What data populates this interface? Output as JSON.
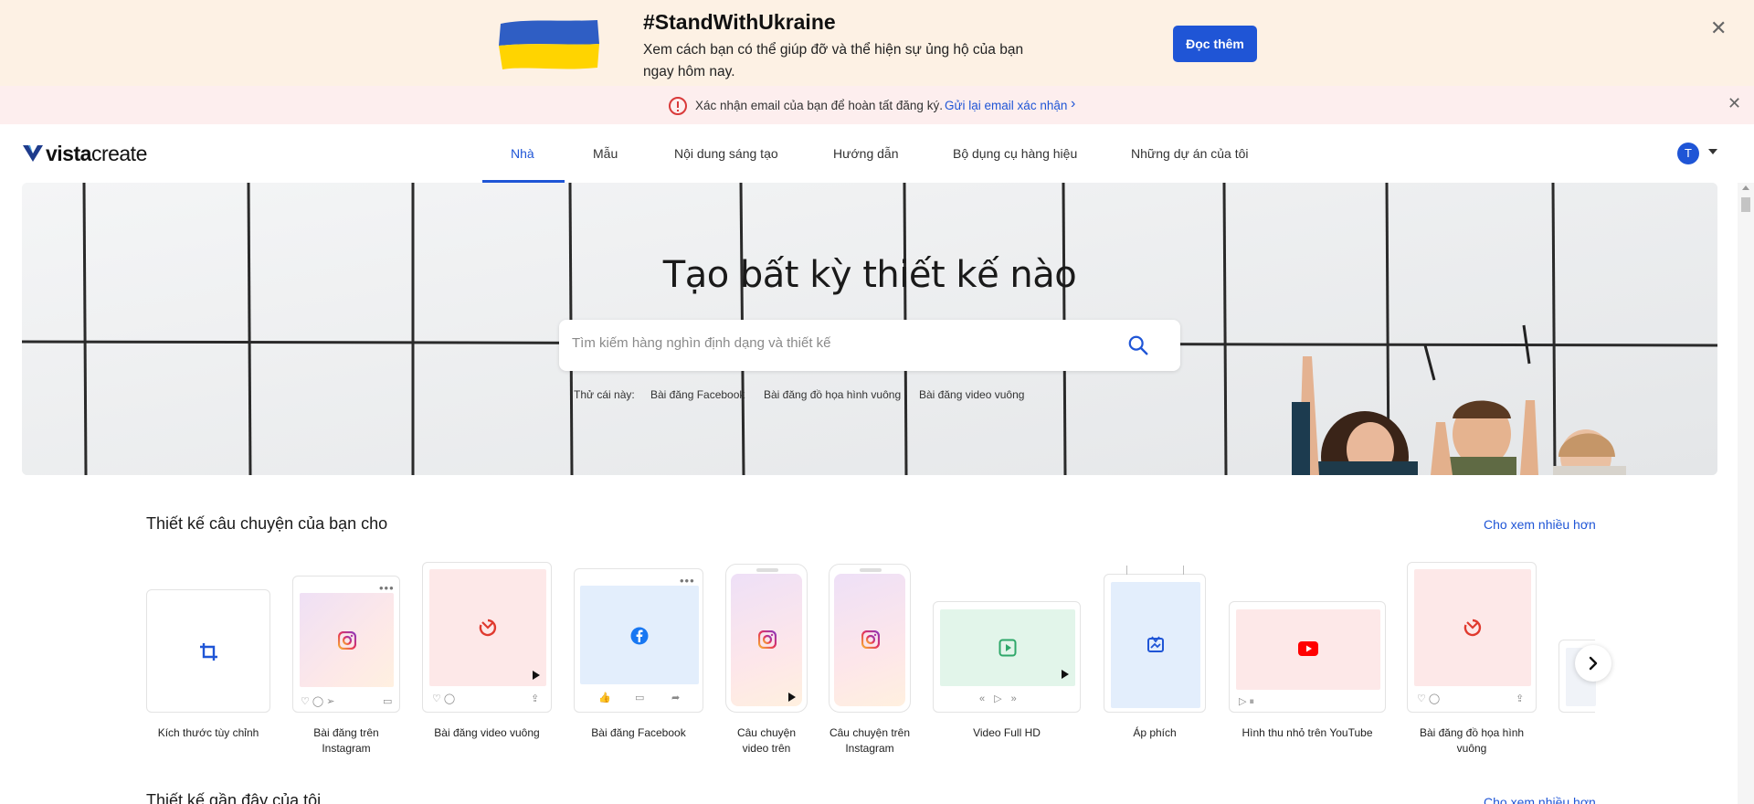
{
  "ukraine_banner": {
    "title": "#StandWithUkraine",
    "description": "Xem cách bạn có thể giúp đỡ và thể hiện sự ủng hộ của bạn ngay hôm nay.",
    "button_label": "Đọc thêm",
    "flag_colors": [
      "#2f5ec4",
      "#ffd400"
    ]
  },
  "email_banner": {
    "message": "Xác nhận email của bạn để hoàn tất đăng ký.",
    "link_label": "Gửi lại email xác nhận"
  },
  "header": {
    "logo_bold": "vista",
    "logo_light": "create",
    "nav": [
      "Nhà",
      "Mẫu",
      "Nội dung sáng tạo",
      "Hướng dẫn",
      "Bộ dụng cụ hàng hiệu",
      "Những dự án của tôi"
    ],
    "active_nav": "Nhà",
    "avatar_initial": "T"
  },
  "hero": {
    "title": "Tạo bất kỳ thiết kế nào",
    "search_placeholder": "Tìm kiếm hàng nghìn định dạng và thiết kế",
    "try_label": "Thử cái này:",
    "suggestions": [
      "Bài đăng Facebook",
      "Bài đăng đồ họa hình vuông",
      "Bài đăng video vuông"
    ]
  },
  "section": {
    "title": "Thiết kế câu chuyện của bạn cho",
    "more_label": "Cho xem nhiều hơn",
    "formats": [
      {
        "label": "Kích thước tùy chỉnh",
        "icon": "crop-icon"
      },
      {
        "label": "Bài đăng trên Instagram",
        "icon": "instagram-icon"
      },
      {
        "label": "Bài đăng video vuông",
        "icon": "vista-icon"
      },
      {
        "label": "Bài đăng Facebook",
        "icon": "facebook-icon"
      },
      {
        "label": "Câu chuyện video trên",
        "icon": "instagram-icon"
      },
      {
        "label": "Câu chuyện trên Instagram",
        "icon": "instagram-icon"
      },
      {
        "label": "Video Full HD",
        "icon": "play-icon"
      },
      {
        "label": "Áp phích",
        "icon": "poster-icon"
      },
      {
        "label": "Hình thu nhỏ trên YouTube",
        "icon": "youtube-icon"
      },
      {
        "label": "Bài đăng đồ họa hình vuông",
        "icon": "vista-icon"
      }
    ]
  },
  "section2": {
    "title": "Thiết kế gần đây của tôi",
    "more_label": "Cho xem nhiều hơn"
  },
  "colors": {
    "accent": "#1f55d6",
    "ukraine_bg": "#fdf1e4",
    "email_bg": "#fdeeee"
  }
}
